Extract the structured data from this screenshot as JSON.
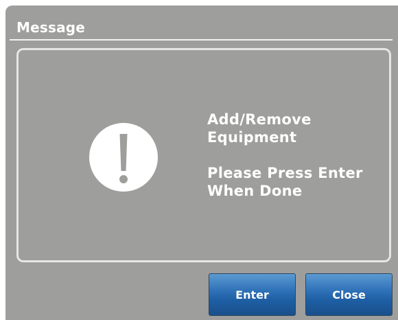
{
  "dialog": {
    "title": "Message",
    "icon": "exclamation-icon",
    "message": {
      "line1": "Add/Remove",
      "line2": "Equipment",
      "line3": "Please Press Enter",
      "line4": "When Done"
    },
    "buttons": {
      "enter_label": "Enter",
      "close_label": "Close"
    }
  },
  "colors": {
    "dialog_background": "#9e9e9c",
    "text": "#ffffff",
    "button_blue": "#1d5ea3"
  }
}
